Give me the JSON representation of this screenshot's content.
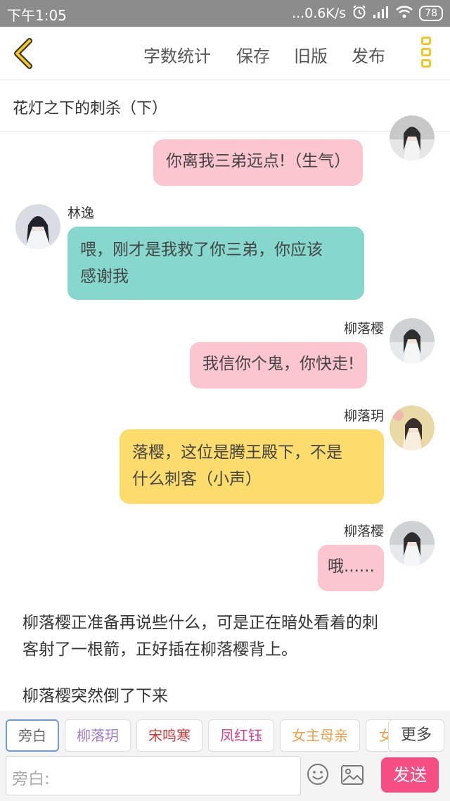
{
  "status_bar": {
    "time": "下午1:05",
    "network_speed": "...0.6K/s",
    "battery": "78"
  },
  "toolbar": {
    "word_count_label": "字数统计",
    "save_label": "保存",
    "old_version_label": "旧版",
    "publish_label": "发布"
  },
  "chapter": {
    "title": "花灯之下的刺杀（下）"
  },
  "messages": [
    {
      "speaker": "",
      "text": "你离我三弟远点!（生气）",
      "side": "right",
      "color": "#fcc6d1"
    },
    {
      "speaker": "林逸",
      "text_lines": [
        "喂，刚才是我救了你三弟，你应该",
        "感谢我"
      ],
      "side": "left",
      "color": "#86d8ce"
    },
    {
      "speaker": "柳落樱",
      "text": "我信你个鬼，你快走!",
      "side": "right",
      "color": "#fcc6d1"
    },
    {
      "speaker": "柳落玥",
      "text_lines": [
        "落樱，这位是腾王殿下，不是",
        "什么刺客（小声）"
      ],
      "side": "right",
      "color": "#fcdc6c"
    },
    {
      "speaker": "柳落樱",
      "text": "哦......",
      "side": "right",
      "color": "#fcc6d1"
    }
  ],
  "narrations": [
    {
      "lines": [
        "柳落樱正准备再说些什么，可是正在暗处看着的刺",
        "客射了一根箭，正好插在柳落樱背上。"
      ]
    },
    {
      "lines": [
        "柳落樱突然倒了下来"
      ]
    }
  ],
  "roles": [
    {
      "label": "旁白",
      "color": "#666666"
    },
    {
      "label": "柳落玥",
      "color": "#a07cc5"
    },
    {
      "label": "宋鸣寒",
      "color": "#d33b3b"
    },
    {
      "label": "凤红钰",
      "color": "#d93f8c"
    },
    {
      "label": "女主母亲",
      "color": "#f0a24b"
    },
    {
      "label": "女",
      "color": "#f0a24b"
    }
  ],
  "more_roles_label": "更多",
  "input": {
    "placeholder": "旁白:"
  },
  "send_label": "发送",
  "colors": {
    "accent": "#f3c623",
    "send": "#f44e85",
    "active_role_border": "#6f9ad8"
  }
}
